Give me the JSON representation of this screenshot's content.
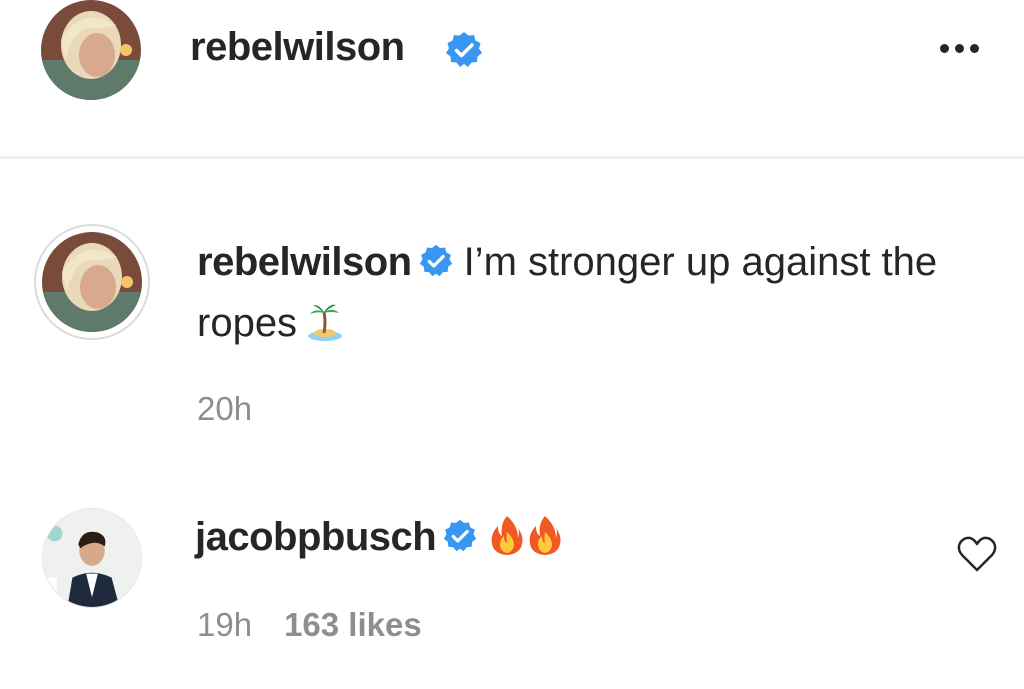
{
  "header": {
    "username": "rebelwilson",
    "verified_icon": "verified-badge-icon",
    "more_icon": "more-options-icon"
  },
  "caption": {
    "username": "rebelwilson",
    "text": "I’m stronger up against the ropes",
    "emoji": "desert-island-emoji",
    "time": "20h"
  },
  "comment": {
    "username": "jacobpbusch",
    "emoji": [
      "fire-emoji",
      "fire-emoji"
    ],
    "time": "19h",
    "likes": "163 likes",
    "like_icon": "heart-outline-icon"
  },
  "colors": {
    "text": "#262626",
    "secondary_text": "#8e8e8e",
    "verified_blue": "#3897f0",
    "divider": "#efefef"
  }
}
